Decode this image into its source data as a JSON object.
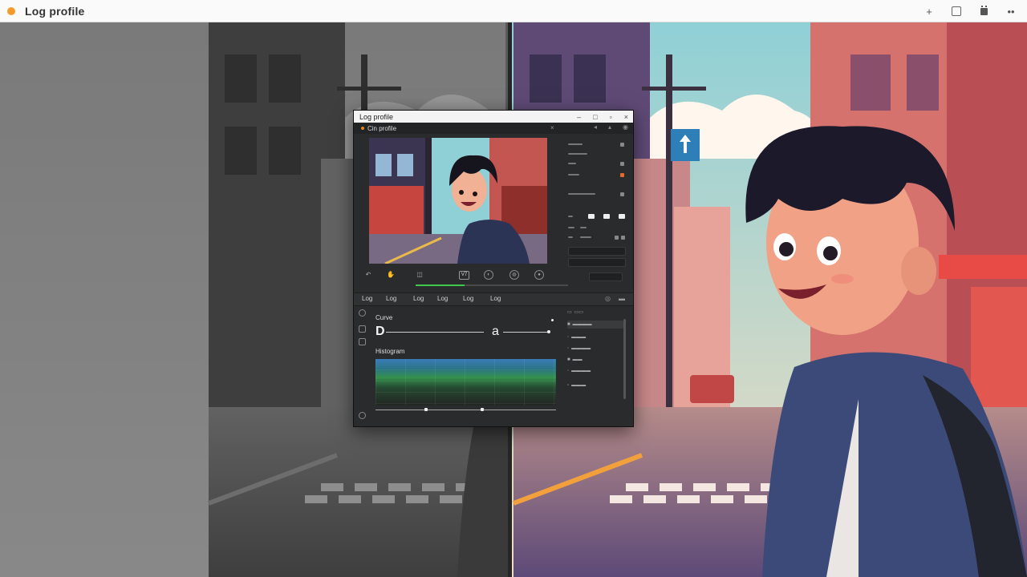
{
  "app": {
    "title": "Log profile",
    "accent": "#f39a2b"
  },
  "titlebar": {
    "icons": [
      "plus-icon",
      "square-icon",
      "calendar-icon",
      "more-icon"
    ],
    "plus_glyph": "+",
    "more_glyph": "••"
  },
  "window": {
    "title": "Log profile",
    "controls": {
      "minimize": "–",
      "maximize": "□",
      "close": "×"
    },
    "toolbar_label": "Cin profile",
    "tabs": [
      "Log",
      "Log",
      "Log",
      "Log",
      "Log",
      "Log"
    ],
    "curve_panel": {
      "label_top": "Curve",
      "label_bottom": "Histogram",
      "left_letter": "D",
      "right_letter": "a"
    },
    "progress": 0.32
  }
}
